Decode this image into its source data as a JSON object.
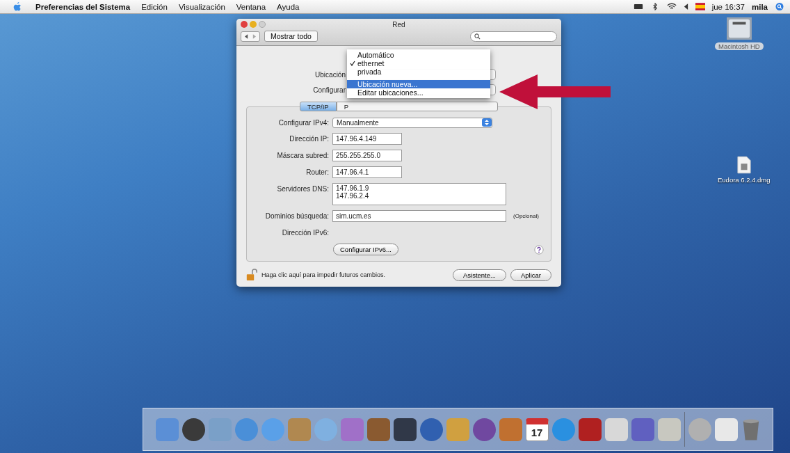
{
  "menubar": {
    "app": "Preferencias del Sistema",
    "menus": [
      "Edición",
      "Visualización",
      "Ventana",
      "Ayuda"
    ],
    "clock": "jue 16:37",
    "user": "mila"
  },
  "desktop_icons": [
    {
      "kind": "disk",
      "label": "Macintosh HD"
    },
    {
      "kind": "file",
      "label": "Eudora 6.2.4.dmg"
    }
  ],
  "window": {
    "title": "Red",
    "show_all": "Mostrar todo",
    "location_label": "Ubicación",
    "configure_label": "Configurar",
    "tabs": [
      {
        "label": "TCP/IP",
        "selected": true
      },
      {
        "label": "P",
        "selected": false
      }
    ],
    "rows": [
      {
        "kind": "select",
        "label": "Configurar IPv4:",
        "value": "Manualmente"
      },
      {
        "kind": "field",
        "label": "Dirección IP:",
        "value": "147.96.4.149"
      },
      {
        "kind": "field",
        "label": "Máscara subred:",
        "value": "255.255.255.0"
      },
      {
        "kind": "field",
        "label": "Router:",
        "value": "147.96.4.1"
      },
      {
        "kind": "textarea",
        "label": "Servidores DNS:",
        "lines": [
          "147.96.1.9",
          "147.96.2.4"
        ]
      },
      {
        "kind": "wide",
        "label": "Dominios búsqueda:",
        "value": "sim.ucm.es",
        "note": "(Opcional)"
      },
      {
        "kind": "label",
        "label": "Dirección IPv6:"
      }
    ],
    "ipv6_button": "Configurar IPv6...",
    "lock_text": "Haga clic aquí para impedir futuros cambios.",
    "buttons": [
      "Asistente...",
      "Aplicar"
    ],
    "menu": [
      {
        "kind": "item",
        "label": "Automático",
        "checked": false,
        "highlighted": false
      },
      {
        "kind": "item",
        "label": "ethernet",
        "checked": true,
        "highlighted": false
      },
      {
        "kind": "item",
        "label": "privada",
        "checked": false,
        "highlighted": false
      },
      {
        "kind": "separator"
      },
      {
        "kind": "item",
        "label": "Ubicación nueva...",
        "checked": false,
        "highlighted": true
      },
      {
        "kind": "item",
        "label": "Editar ubicaciones...",
        "checked": false,
        "highlighted": false
      }
    ]
  },
  "dock": {
    "apps": [
      {
        "kind": "square",
        "color": "#5b8fd6"
      },
      {
        "kind": "round",
        "color": "#3a3a3a"
      },
      {
        "kind": "square",
        "color": "#7aa0c8"
      },
      {
        "kind": "round",
        "color": "#4a8fd8"
      },
      {
        "kind": "round",
        "color": "#5aa0e8"
      },
      {
        "kind": "square",
        "color": "#b08850"
      },
      {
        "kind": "round",
        "color": "#7fb0e0"
      },
      {
        "kind": "square",
        "color": "#a070c8"
      },
      {
        "kind": "square",
        "color": "#8a5a30"
      },
      {
        "kind": "square",
        "color": "#303848"
      },
      {
        "kind": "round",
        "color": "#3060b0"
      },
      {
        "kind": "square",
        "color": "#d0a040"
      },
      {
        "kind": "round",
        "color": "#7048a0"
      },
      {
        "kind": "square",
        "color": "#c07030"
      },
      {
        "kind": "calendar",
        "color": "#d03030",
        "label": "17"
      },
      {
        "kind": "round",
        "color": "#2a90e0"
      },
      {
        "kind": "square",
        "color": "#b02020"
      },
      {
        "kind": "square",
        "color": "#d8d8d8"
      },
      {
        "kind": "square",
        "color": "#6060c0"
      },
      {
        "kind": "square",
        "color": "#c8c8c0"
      }
    ],
    "stacks": [
      {
        "kind": "round",
        "color": "#b0b0b0"
      },
      {
        "kind": "square",
        "color": "#e8e8e8"
      },
      {
        "kind": "trash",
        "color": "#707070"
      }
    ]
  }
}
